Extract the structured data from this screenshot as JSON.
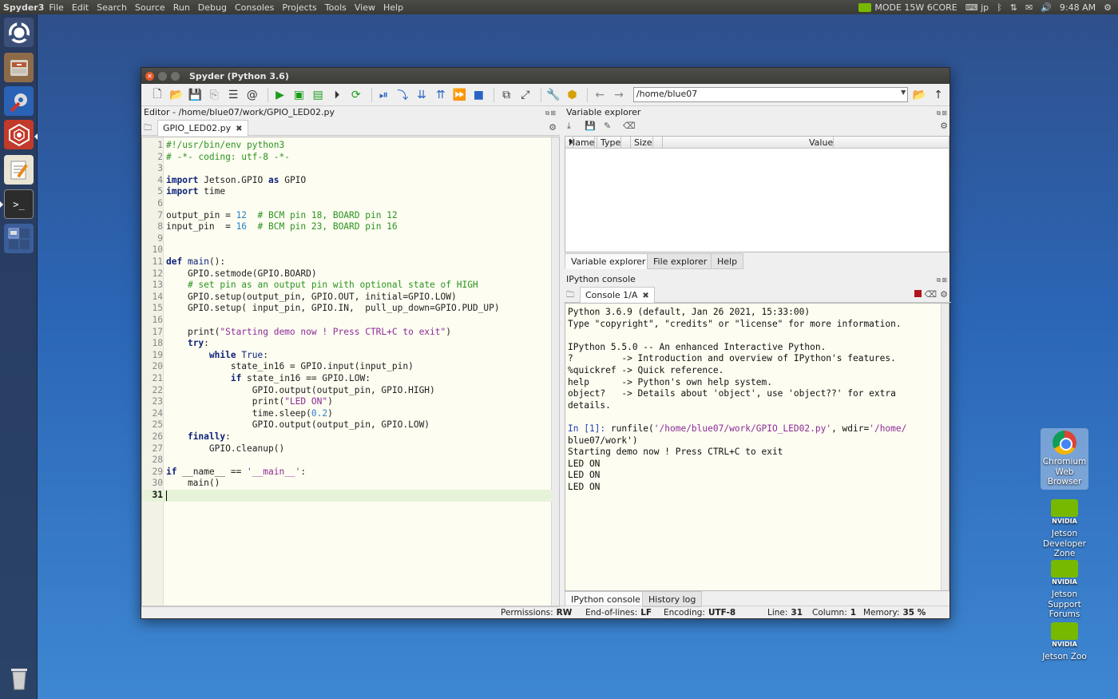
{
  "top_panel": {
    "app_name": "Spyder3",
    "menus": [
      "File",
      "Edit",
      "Search",
      "Source",
      "Run",
      "Debug",
      "Consoles",
      "Projects",
      "Tools",
      "View",
      "Help"
    ],
    "power_mode": "MODE 15W 6CORE",
    "keyboard": "jp",
    "time": "9:48 AM"
  },
  "window": {
    "title": "Spyder (Python 3.6)",
    "path": "/home/blue07"
  },
  "editor": {
    "title": "Editor - /home/blue07/work/GPIO_LED02.py",
    "tab": "GPIO_LED02.py",
    "lines": [
      "#!/usr/bin/env python3",
      "# -*- coding: utf-8 -*-",
      "",
      "import Jetson.GPIO as GPIO",
      "import time",
      "",
      "output_pin = 12  # BCM pin 18, BOARD pin 12",
      "input_pin  = 16  # BCM pin 23, BOARD pin 16",
      "",
      "",
      "def main():",
      "    GPIO.setmode(GPIO.BOARD)",
      "    # set pin as an output pin with optional state of HIGH",
      "    GPIO.setup(output_pin, GPIO.OUT, initial=GPIO.LOW)",
      "    GPIO.setup( input_pin, GPIO.IN,  pull_up_down=GPIO.PUD_UP)",
      "",
      "    print(\"Starting demo now ! Press CTRL+C to exit\")",
      "    try:",
      "        while True:",
      "            state_in16 = GPIO.input(input_pin)",
      "            if state_in16 == GPIO.LOW:",
      "                GPIO.output(output_pin, GPIO.HIGH)",
      "                print(\"LED ON\")",
      "                time.sleep(0.2)",
      "                GPIO.output(output_pin, GPIO.LOW)",
      "    finally:",
      "        GPIO.cleanup()",
      "",
      "if __name__ == '__main__':",
      "    main()",
      ""
    ],
    "current_line": 31
  },
  "variable_explorer": {
    "title": "Variable explorer",
    "columns": [
      "Name",
      "Type",
      "Size",
      "Value"
    ],
    "tabs": [
      "Variable explorer",
      "File explorer",
      "Help"
    ]
  },
  "ipython": {
    "title": "IPython console",
    "tab": "Console 1/A",
    "lines": [
      "Python 3.6.9 (default, Jan 26 2021, 15:33:00)",
      "Type \"copyright\", \"credits\" or \"license\" for more information.",
      "",
      "IPython 5.5.0 -- An enhanced Interactive Python.",
      "?         -> Introduction and overview of IPython's features.",
      "%quickref -> Quick reference.",
      "help      -> Python's own help system.",
      "object?   -> Details about 'object', use 'object??' for extra",
      "details.",
      "",
      "In [1]: runfile('/home/blue07/work/GPIO_LED02.py', wdir='/home/",
      "blue07/work')",
      "Starting demo now ! Press CTRL+C to exit",
      "LED ON",
      "LED ON",
      "LED ON"
    ],
    "tabs": [
      "IPython console",
      "History log"
    ]
  },
  "status": {
    "permissions_label": "Permissions:",
    "permissions": "RW",
    "eol_label": "End-of-lines:",
    "eol": "LF",
    "encoding_label": "Encoding:",
    "encoding": "UTF-8",
    "line_label": "Line:",
    "line": "31",
    "column_label": "Column:",
    "column": "1",
    "memory_label": "Memory:",
    "memory": "35 %"
  },
  "desktop_icons": [
    {
      "label": "Chromium Web Browser",
      "icon": "chromium-icon"
    },
    {
      "label": "Jetson Developer Zone",
      "icon": "nvidia-icon"
    },
    {
      "label": "Jetson Support Forums",
      "icon": "nvidia-icon"
    },
    {
      "label": "Jetson Zoo",
      "icon": "nvidia-icon"
    }
  ],
  "launcher_icons": [
    "ubuntu-logo-icon",
    "file-cabinet-icon",
    "settings-tools-icon",
    "spyder-web-icon",
    "text-editor-icon",
    "terminal-icon",
    "workspaces-icon",
    "trash-icon"
  ]
}
